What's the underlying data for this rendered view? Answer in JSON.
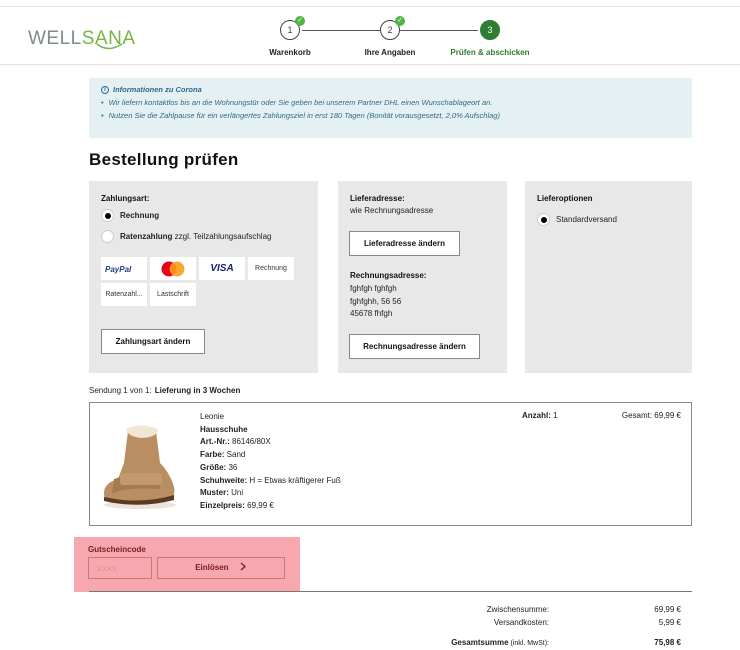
{
  "header": {
    "logo_part1": "WELL",
    "logo_part2": "SANA",
    "steps": [
      {
        "number": "1",
        "label": "Warenkorb"
      },
      {
        "number": "2",
        "label": "Ihre Angaben"
      },
      {
        "number": "3",
        "label": "Prüfen & abschicken"
      }
    ],
    "check_glyph": "✓"
  },
  "info": {
    "title": "Informationen zu Corona",
    "bullets": [
      "Wir liefern kontaktlos bis an die Wohnungstür oder Sie geben bei unserem Partner DHL einen Wunschablageort an.",
      "Nutzen Sie die Zahlpause für ein verlängertes Zahlungsziel in erst 180 Tagen (Bonität vorausgesetzt, 2,0% Aufschlag)"
    ]
  },
  "page_title": "Bestellung prüfen",
  "payment": {
    "title": "Zahlungsart:",
    "option1": "Rechnung",
    "option2_bold": "Ratenzahlung",
    "option2_rest": " zzgl. Teilzahlungsaufschlag",
    "logos": [
      "PayPal",
      "Mastercard",
      "VISA",
      "Rechnung",
      "Ratenzahl...",
      "Lastschrift"
    ],
    "change_button": "Zahlungsart ändern"
  },
  "address": {
    "delivery_title": "Lieferadresse:",
    "delivery_value": "wie Rechnungsadresse",
    "delivery_button": "Lieferadresse ändern",
    "billing_title": "Rechnungsadresse:",
    "billing_lines": [
      "fghfgh fghfgh",
      "fghfghh, 56 56",
      "45678 fhfgh"
    ],
    "billing_button": "Rechnungsadresse ändern"
  },
  "delivery_options": {
    "title": "Lieferoptionen",
    "selected": "Standardversand"
  },
  "shipment": {
    "prefix": "Sendung 1 von 1:",
    "label": "Lieferung in 3 Wochen"
  },
  "item": {
    "brand": "Leonie",
    "name": "Hausschuhe",
    "art_label": "Art.-Nr.:",
    "art_value": " 86146/80X",
    "farbe_label": "Farbe:",
    "farbe_value": " Sand",
    "groesse_label": "Größe:",
    "groesse_value": " 36",
    "schuhweite_label": "Schuhweite:",
    "schuhweite_value": " H = Etwas kräftigerer Fuß",
    "muster_label": "Muster:",
    "muster_value": " Uni",
    "preis_label": "Einzelpreis:",
    "preis_value": " 69,99 €",
    "qty_label": "Anzahl:",
    "qty_value": " 1",
    "total": "Gesamt: 69,99 €"
  },
  "voucher": {
    "label": "Gutscheincode",
    "placeholder": "XXXX",
    "button": "Einlösen"
  },
  "summary": {
    "subtotal_label": "Zwischensumme:",
    "subtotal_value": "69,99 €",
    "shipping_label": "Versandkosten:",
    "shipping_value": "5,99 €",
    "total_label": "Gesamtsumme",
    "total_note": " (inkl. MwSt):",
    "total_value": "75,98 €"
  },
  "colors": {
    "brand_green": "#2e7d32",
    "voucher_highlight": "#f7a8ae",
    "info_bg": "#e4f0f1"
  }
}
